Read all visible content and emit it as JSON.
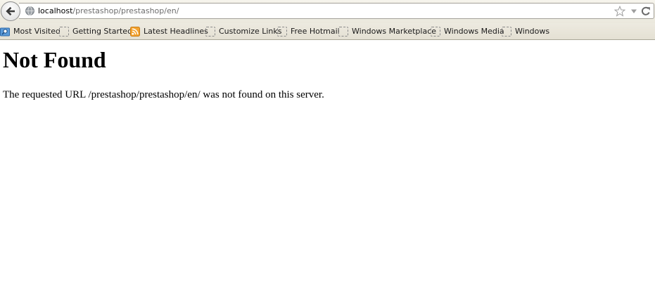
{
  "browser": {
    "url_host": "localhost",
    "url_path": "/prestashop/prestashop/en/"
  },
  "bookmarks": [
    {
      "label": "Most Visited",
      "icon": "search-folder-icon"
    },
    {
      "label": "Getting Started",
      "icon": "bookmark-icon"
    },
    {
      "label": "Latest Headlines",
      "icon": "rss-feed-icon"
    },
    {
      "label": "Customize Links",
      "icon": "bookmark-icon"
    },
    {
      "label": "Free Hotmail",
      "icon": "bookmark-icon"
    },
    {
      "label": "Windows Marketplace",
      "icon": "bookmark-icon"
    },
    {
      "label": "Windows Media",
      "icon": "bookmark-icon"
    },
    {
      "label": "Windows",
      "icon": "bookmark-icon"
    }
  ],
  "page": {
    "heading": "Not Found",
    "message": "The requested URL /prestashop/prestashop/en/ was not found on this server."
  },
  "colors": {
    "toolbar_background": "#ebe8dd",
    "rss_orange": "#f3a330",
    "search_blue": "#3a7fd0"
  }
}
